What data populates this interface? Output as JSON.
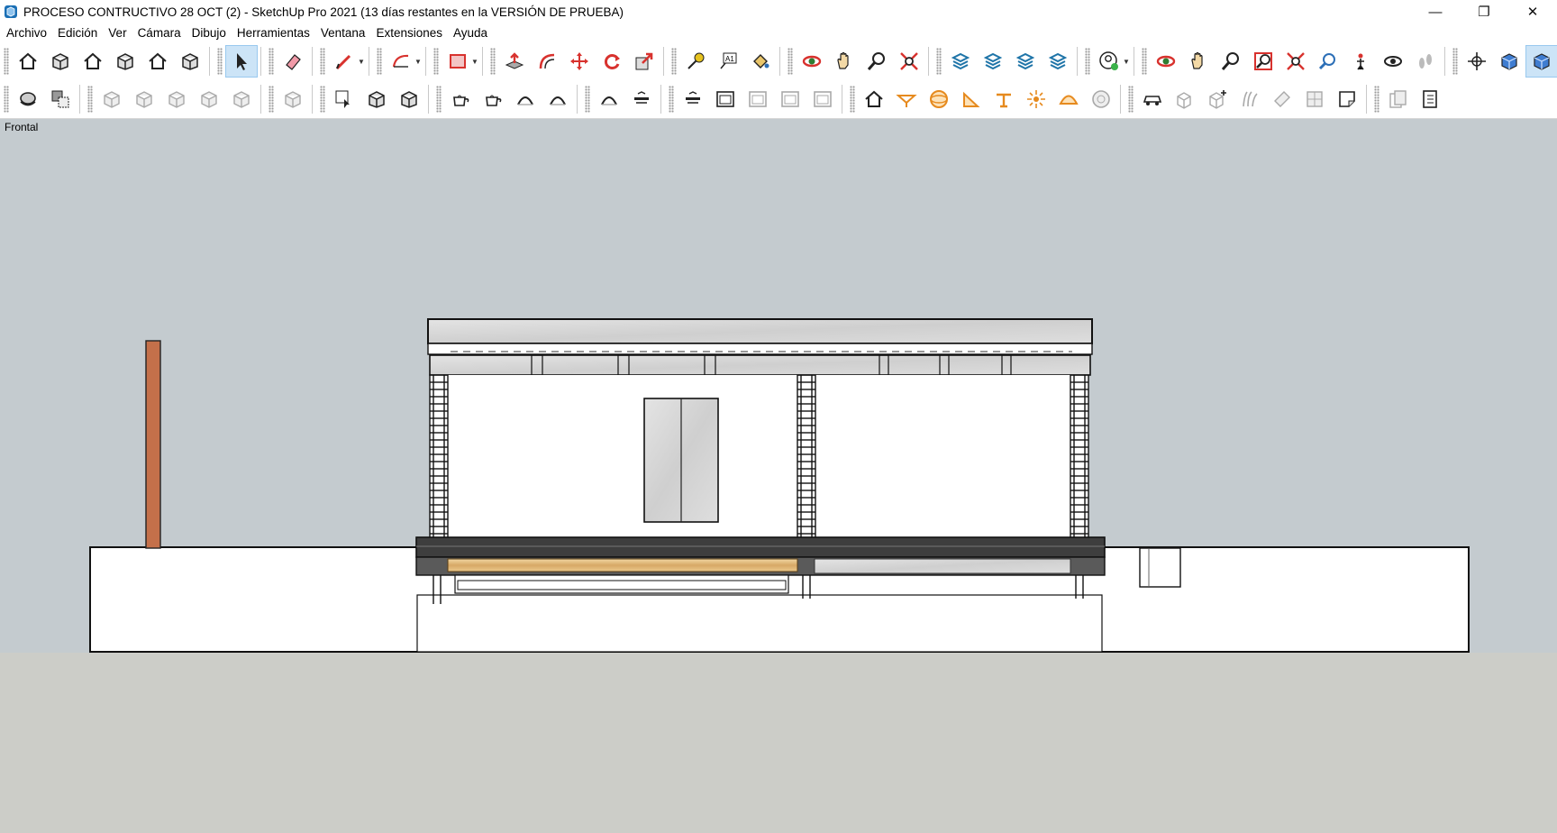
{
  "window": {
    "title": "PROCESO CONTRUCTIVO 28 OCT (2) - SketchUp Pro 2021 (13 días restantes en la VERSIÓN DE PRUEBA)",
    "minimize": "—",
    "restore": "❐",
    "close": "✕"
  },
  "menu": {
    "items": [
      "Archivo",
      "Edición",
      "Ver",
      "Cámara",
      "Dibujo",
      "Herramientas",
      "Ventana",
      "Extensiones",
      "Ayuda"
    ]
  },
  "viewport": {
    "scene_label": "Frontal"
  },
  "icons": {
    "toolbar_row1": [
      "3d-warehouse-icon",
      "component-icon",
      "home-icon",
      "open-box-icon",
      "house-outline-icon",
      "box-icon",
      "select-arrow-icon",
      "eraser-icon",
      "pencil-line-icon",
      "arc-icon",
      "rectangle-icon",
      "push-pull-icon",
      "offset-icon",
      "move-icon",
      "rotate-icon",
      "scale-icon",
      "tape-measure-icon",
      "text-label-icon",
      "paint-bucket-icon",
      "orbit-icon",
      "pan-icon",
      "zoom-icon",
      "zoom-extents-icon",
      "outliner-icon",
      "tags-icon",
      "layers-icon",
      "styles-icon",
      "account-icon",
      "orbit-icon",
      "pan-icon",
      "zoom-icon",
      "zoom-window-icon",
      "zoom-extents-icon",
      "previous-view-icon",
      "position-camera-icon",
      "look-around-icon",
      "walk-icon",
      "axes-icon",
      "section-plane-icon",
      "display-section-icon",
      "section-fill-icon"
    ],
    "toolbar_row2": [
      "solid-union-icon",
      "solid-subtract-icon",
      "xray-icon",
      "wireframe-icon",
      "hidden-line-icon",
      "shaded-icon",
      "textured-icon",
      "monochrome-icon",
      "component-options-icon",
      "sandbox-smoove-icon",
      "sandbox-stamp-icon",
      "teapot-icon",
      "teapot-edit-icon",
      "drape-icon",
      "add-detail-icon",
      "flip-edge-icon",
      "match-photo-icon",
      "match-photo-edit-icon",
      "frame-icon",
      "frame-2-icon",
      "frame-3-icon",
      "frame-4-icon",
      "sun-house-icon",
      "umbrella-icon",
      "sphere-icon",
      "protractor-icon",
      "table-icon",
      "light-icon",
      "dome-icon",
      "circle-gray-icon",
      "car-icon",
      "cube-outline-icon",
      "cube-plus-icon",
      "grass-icon",
      "ruler-diagonal-icon",
      "grid-icon",
      "page-curl-icon",
      "copy-icon",
      "tree-view-icon"
    ]
  }
}
